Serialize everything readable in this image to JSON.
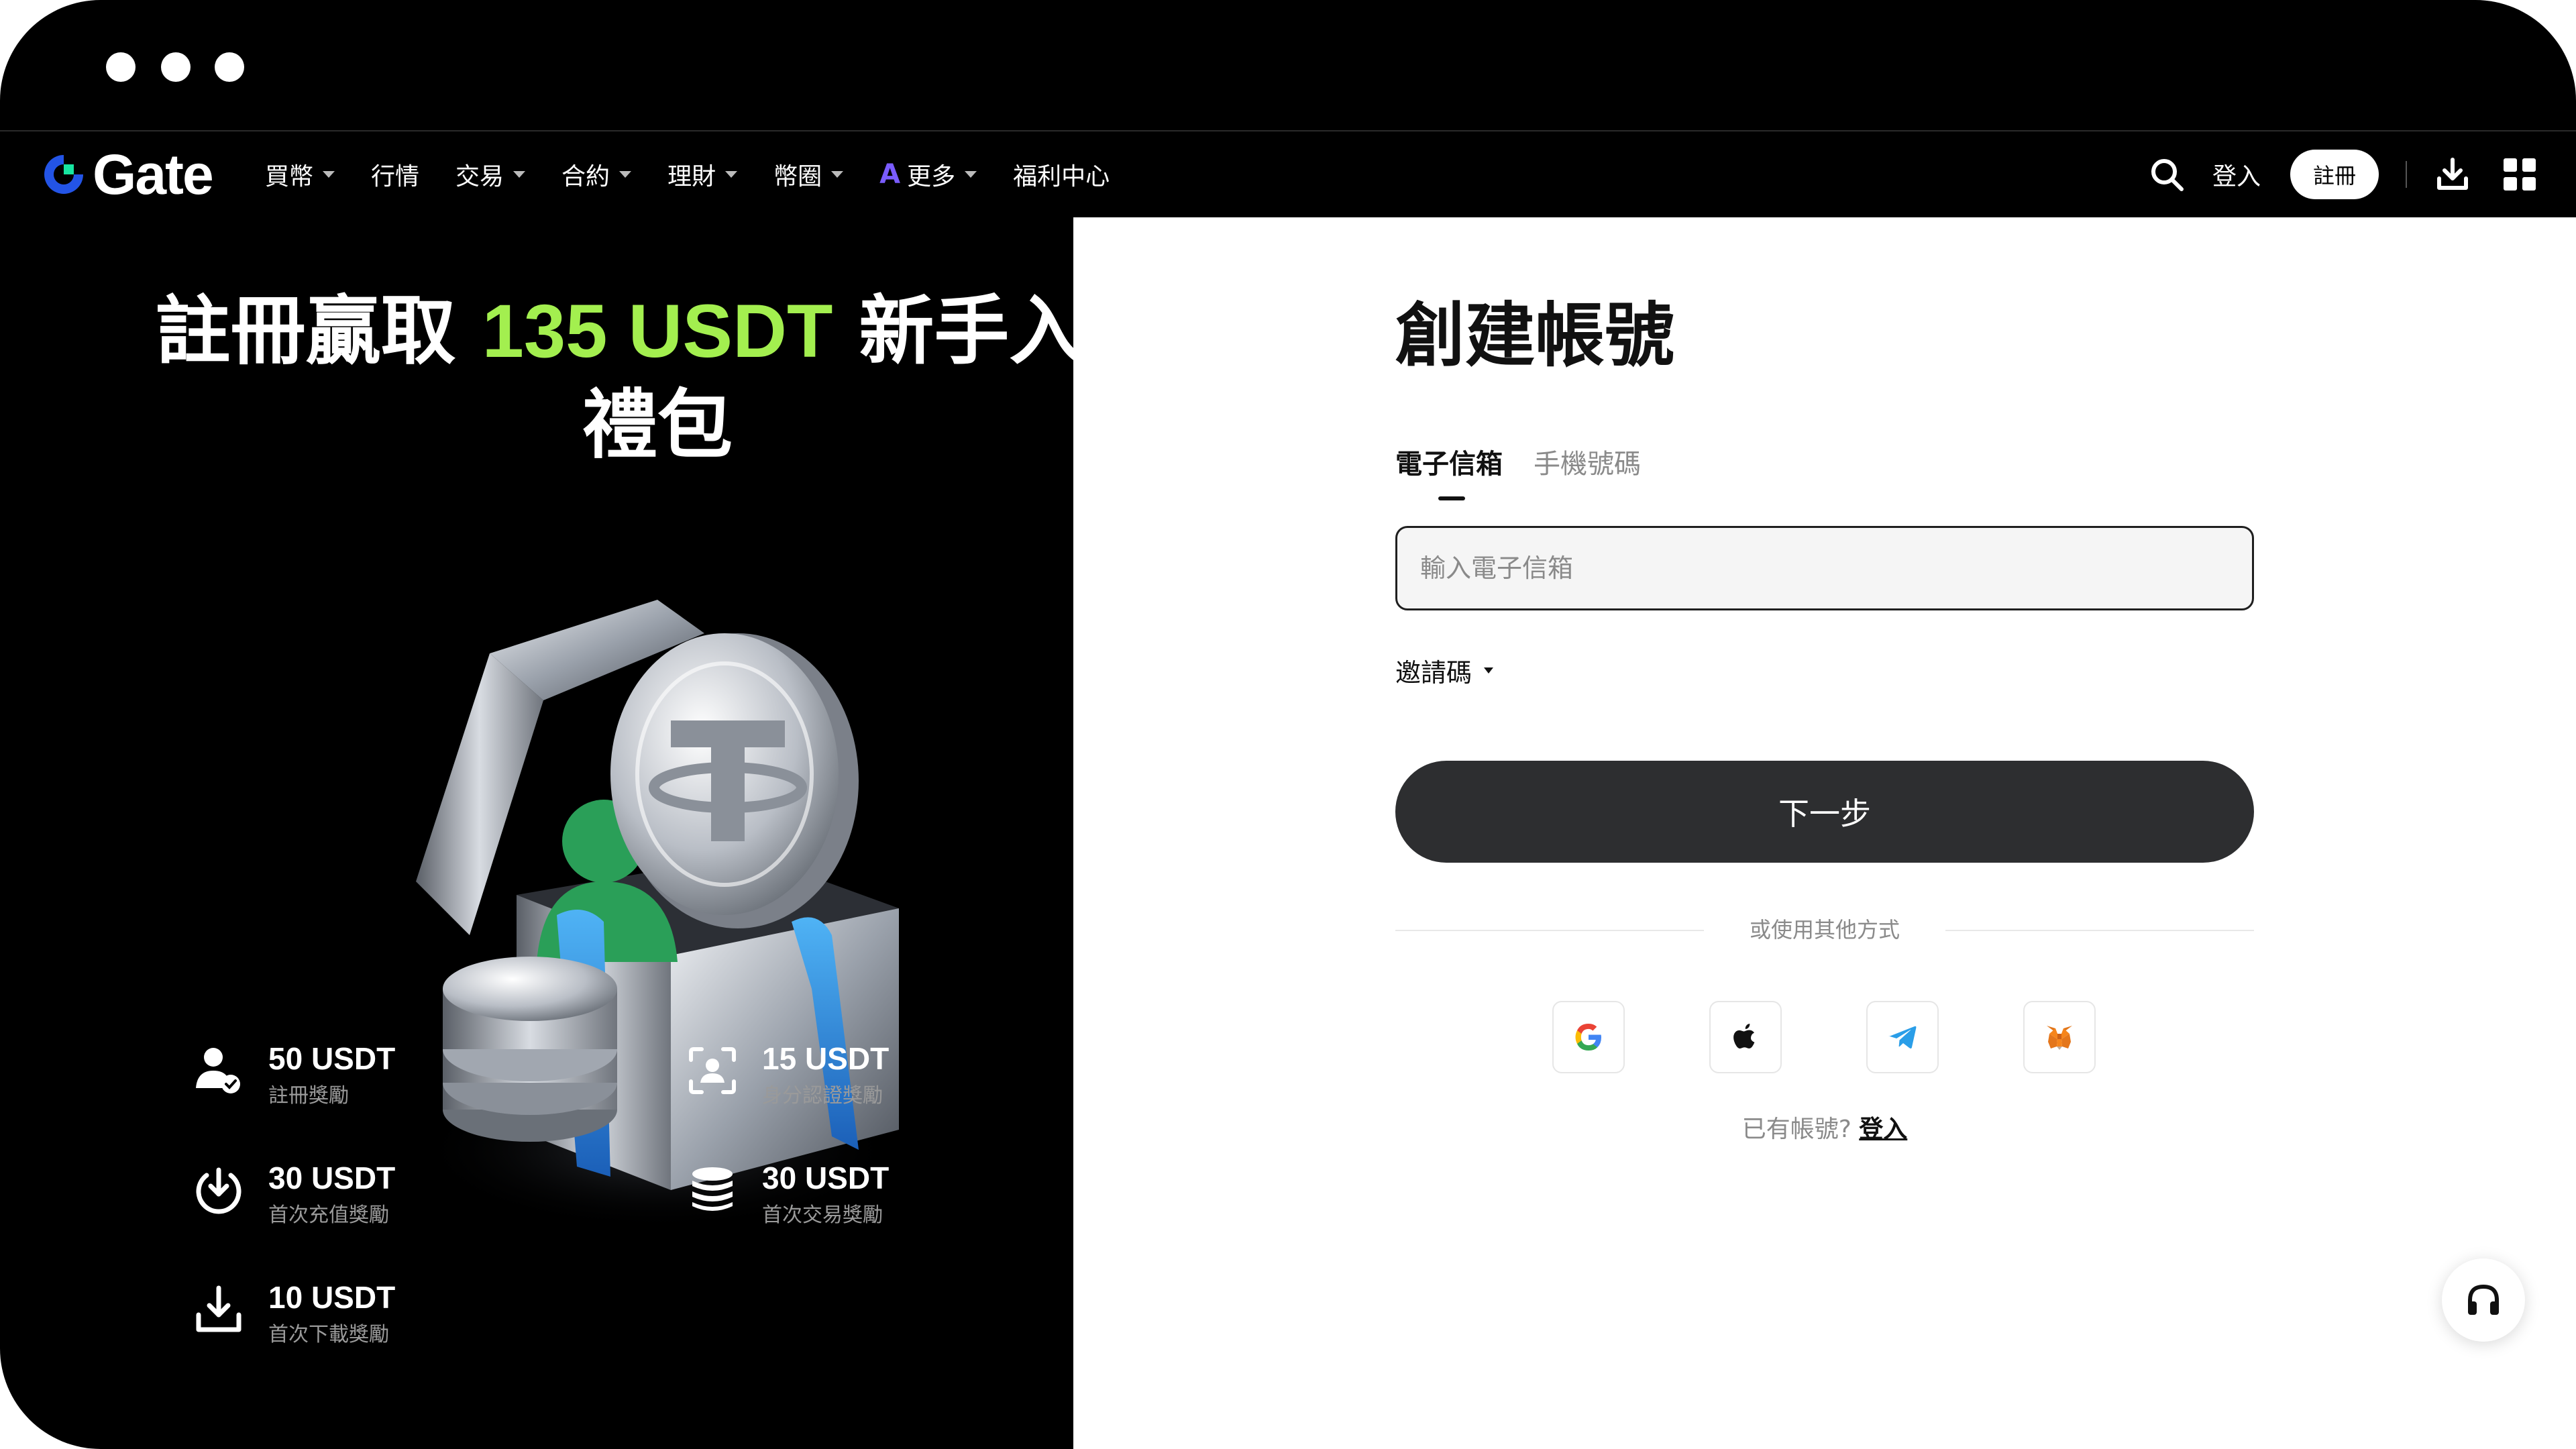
{
  "nav": {
    "logo_text": "Gate",
    "items": [
      {
        "label": "買幣",
        "caret": true
      },
      {
        "label": "行情",
        "caret": false
      },
      {
        "label": "交易",
        "caret": true
      },
      {
        "label": "合約",
        "caret": true
      },
      {
        "label": "理財",
        "caret": true
      },
      {
        "label": "幣圈",
        "caret": true
      },
      {
        "label": "更多",
        "caret": true,
        "ai_badge": "A"
      },
      {
        "label": "福利中心",
        "caret": false
      }
    ],
    "login_label": "登入",
    "signup_label": "註冊"
  },
  "promo": {
    "title_before": "註冊贏取 ",
    "title_highlight": "135 USDT",
    "title_after": " 新手入門",
    "title_line2": "禮包",
    "rewards": [
      {
        "amount": "50 USDT",
        "label": "註冊獎勵",
        "icon": "user-check-icon"
      },
      {
        "amount": "15 USDT",
        "label": "身分認證獎勵",
        "icon": "face-id-icon"
      },
      {
        "amount": "30 USDT",
        "label": "首次充值獎勵",
        "icon": "deposit-icon"
      },
      {
        "amount": "30 USDT",
        "label": "首次交易獎勵",
        "icon": "coins-stack-icon"
      },
      {
        "amount": "10 USDT",
        "label": "首次下載獎勵",
        "icon": "download-icon"
      }
    ]
  },
  "form": {
    "title": "創建帳號",
    "tabs": [
      {
        "label": "電子信箱",
        "active": true
      },
      {
        "label": "手機號碼",
        "active": false
      }
    ],
    "email_placeholder": "輸入電子信箱",
    "email_value": "",
    "invite_label": "邀請碼",
    "next_label": "下一步",
    "other_methods": "或使用其他方式",
    "social": [
      "google-icon",
      "apple-icon",
      "telegram-icon",
      "metamask-icon"
    ],
    "has_account": "已有帳號?",
    "login_link": "登入"
  },
  "colors": {
    "accent_green": "#a3ef4f",
    "button_dark": "#2d2e30",
    "logo_blue": "#2354e6",
    "logo_green": "#17e6a1"
  }
}
